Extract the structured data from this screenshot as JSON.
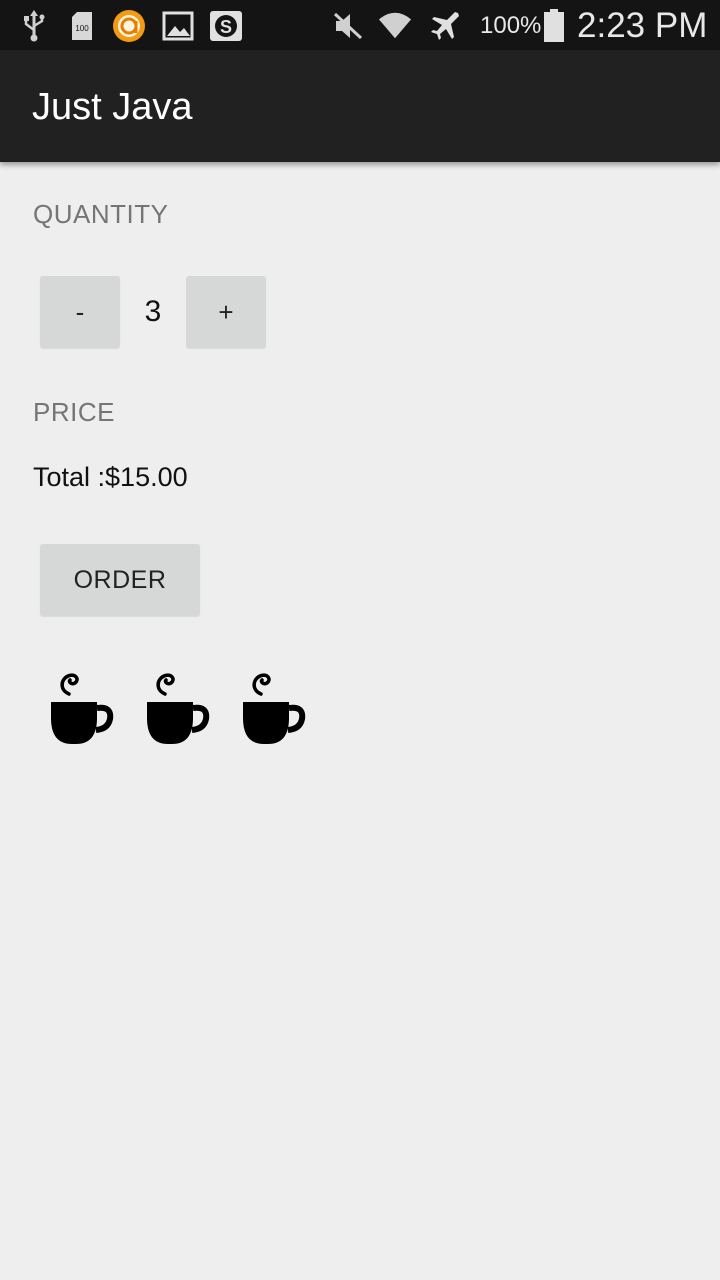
{
  "status_bar": {
    "icons": [
      "usb-icon",
      "sd-card-icon",
      "orange-app-icon",
      "gallery-icon",
      "s-app-icon",
      "mute-icon",
      "wifi-icon",
      "airplane-icon",
      "battery-icon"
    ],
    "sd_label": "100",
    "battery": "100%",
    "time": "2:23 PM"
  },
  "toolbar": {
    "title": "Just Java"
  },
  "quantity": {
    "label": "QUANTITY",
    "decrement": "-",
    "value": "3",
    "increment": "+"
  },
  "price": {
    "label": "PRICE",
    "total": "Total :$15.00"
  },
  "order_button": "ORDER",
  "cups": {
    "count": 3,
    "icon": "coffee-cup-icon"
  }
}
